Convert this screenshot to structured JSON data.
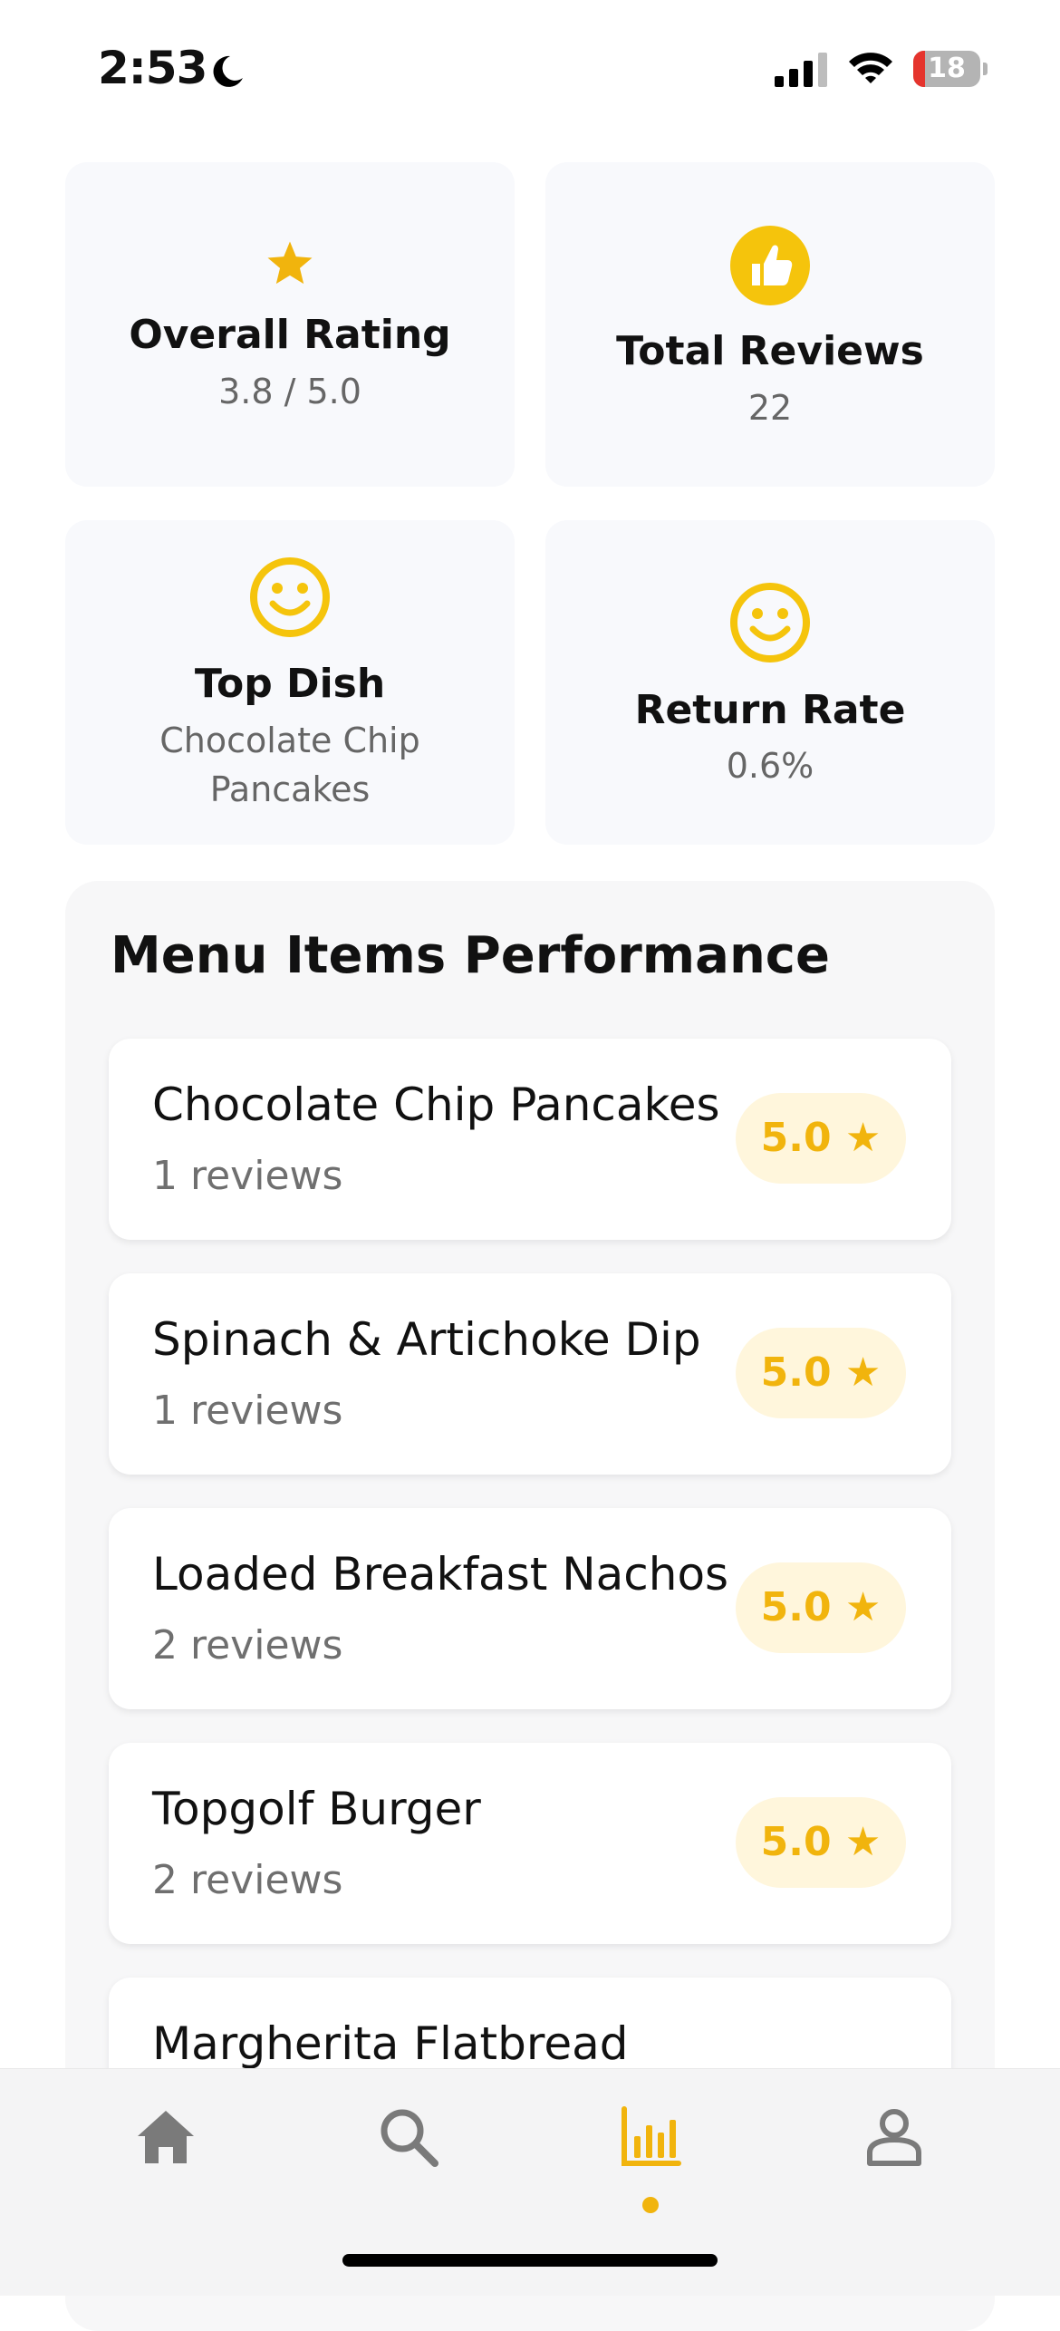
{
  "status_bar": {
    "time": "2:53",
    "battery_level": "18",
    "battery_fraction": 0.18
  },
  "stats": [
    {
      "title": "Overall Rating",
      "value": "3.8 / 5.0",
      "icon": "star-icon"
    },
    {
      "title": "Total Reviews",
      "value": "22",
      "icon": "thumbs-up-icon"
    },
    {
      "title": "Top Dish",
      "value": "Chocolate Chip Pancakes",
      "icon": "smiley-icon"
    },
    {
      "title": "Return Rate",
      "value": "0.6%",
      "icon": "smiley-icon"
    }
  ],
  "performance": {
    "title": "Menu Items Performance",
    "items": [
      {
        "name": "Chocolate Chip Pancakes",
        "reviews": "1 reviews",
        "rating": "5.0 ★"
      },
      {
        "name": "Spinach & Artichoke Dip",
        "reviews": "1 reviews",
        "rating": "5.0 ★"
      },
      {
        "name": "Loaded Breakfast Nachos",
        "reviews": "2 reviews",
        "rating": "5.0 ★"
      },
      {
        "name": "Topgolf Burger",
        "reviews": "2 reviews",
        "rating": "5.0 ★"
      },
      {
        "name": "Margherita Flatbread",
        "reviews": "",
        "rating": ""
      }
    ]
  },
  "bottom_nav": {
    "items": [
      {
        "icon": "home-icon",
        "active": false
      },
      {
        "icon": "search-icon",
        "active": false
      },
      {
        "icon": "analytics-icon",
        "active": true
      },
      {
        "icon": "profile-icon",
        "active": false
      }
    ]
  },
  "colors": {
    "accent": "#f1b40d",
    "badge_bg": "#fff6dc",
    "card_bg": "#f8f9fc",
    "inactive_icon": "#7a7a7a"
  }
}
